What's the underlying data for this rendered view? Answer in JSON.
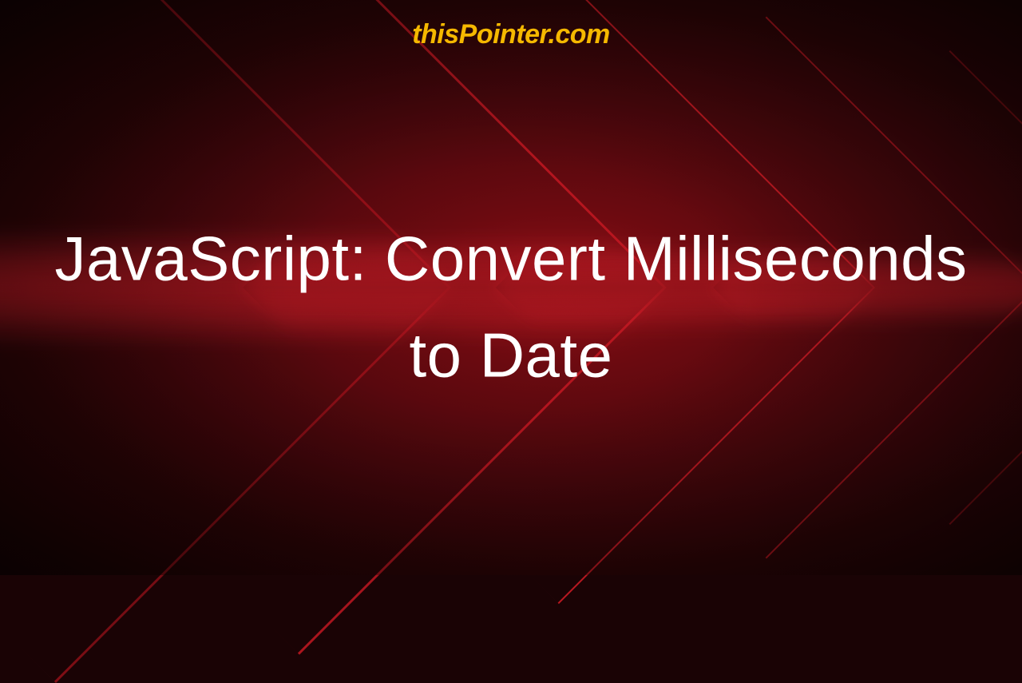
{
  "brand": "thisPointer.com",
  "title": "JavaScript: Convert Milliseconds to Date",
  "colors": {
    "brand_yellow": "#f5b800",
    "background_dark": "#1a0305",
    "accent_red": "#8b0e15",
    "text": "#ffffff"
  }
}
